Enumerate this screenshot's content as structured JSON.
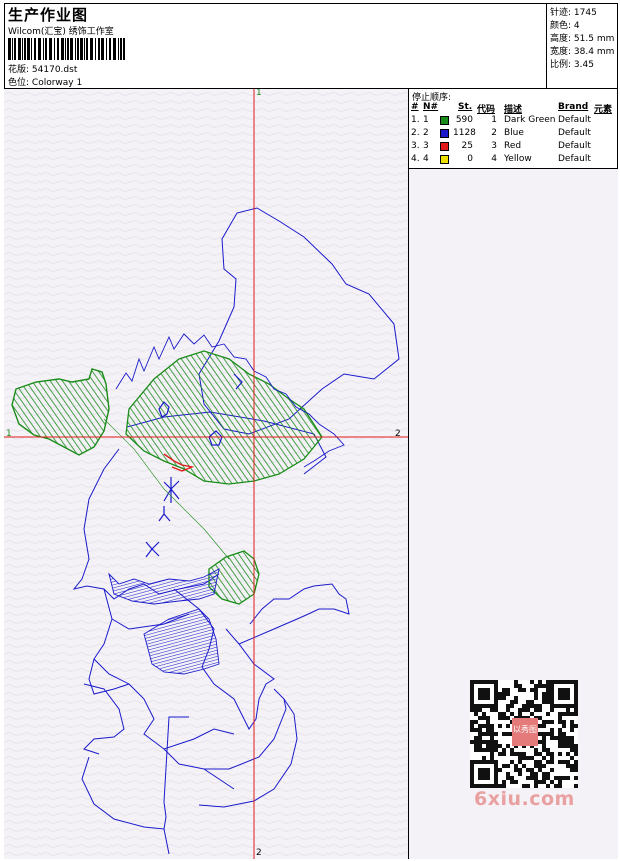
{
  "header": {
    "title": "生产作业图",
    "company": "Wilcom(汇宝) 绣饰工作室",
    "design_label": "花版:",
    "design_value": "54170.dst",
    "colorway_label": "色位:",
    "colorway_value": "Colorway 1"
  },
  "specs": [
    {
      "label": "针迹:",
      "value": "1745"
    },
    {
      "label": "颜色:",
      "value": "4"
    },
    {
      "label": "高度:",
      "value": "51.5 mm"
    },
    {
      "label": "宽度:",
      "value": "38.4 mm"
    },
    {
      "label": "比例:",
      "value": "3.45"
    }
  ],
  "legend": {
    "title": "停止顺序:",
    "columns": [
      "#",
      "N#",
      "St.",
      "代码",
      "描述",
      "Brand",
      "元素"
    ],
    "rows": [
      {
        "index": "1.",
        "n": "1",
        "color": "#1a8c1a",
        "st": "590",
        "code": "1",
        "desc": "Dark Green",
        "brand": "Default"
      },
      {
        "index": "2.",
        "n": "2",
        "color": "#1a1acc",
        "st": "1128",
        "code": "2",
        "desc": "Blue",
        "brand": "Default"
      },
      {
        "index": "3.",
        "n": "3",
        "color": "#e01a1a",
        "st": "25",
        "code": "3",
        "desc": "Red",
        "brand": "Default"
      },
      {
        "index": "4.",
        "n": "4",
        "color": "#f0e000",
        "st": "0",
        "code": "4",
        "desc": "Yellow",
        "brand": "Default"
      }
    ]
  },
  "axes": {
    "x_start": "1",
    "x_end": "2",
    "y_start": "1",
    "y_end": "2"
  },
  "watermark": "6xiu.com",
  "qr_caption": "以秀图"
}
